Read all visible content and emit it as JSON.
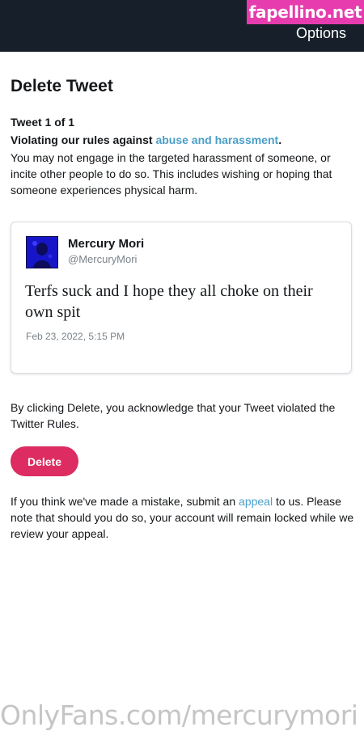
{
  "header": {
    "options_label": "Options"
  },
  "watermarks": {
    "top": "fapellino.net",
    "bottom": "OnlyFans.com/mercurymori"
  },
  "page": {
    "title": "Delete Tweet",
    "tweet_count": "Tweet 1 of 1",
    "rule_prefix": "Violating our rules against ",
    "rule_link": "abuse and harassment",
    "rule_suffix": ".",
    "rule_body": "You may not engage in the targeted harassment of someone, or incite other people to do so. This includes wishing or hoping that someone experiences physical harm."
  },
  "tweet": {
    "author_name": "Mercury Mori",
    "author_handle": "@MercuryMori",
    "text": "Terfs suck and I hope they all choke on their own spit",
    "date": "Feb 23, 2022, 5:15 PM"
  },
  "acknowledgement": "By clicking Delete, you acknowledge that your Tweet violated the Twitter Rules.",
  "delete_button_label": "Delete",
  "appeal": {
    "prefix": "If you think we've made a mistake, submit an ",
    "link": "appeal",
    "suffix": " to us. Please note that should you do so, your account will remain locked while we review your appeal."
  },
  "colors": {
    "header_bg": "#17202a",
    "link": "#4a9fc8",
    "delete_button": "#dc2c61",
    "watermark_badge": "#e63cae"
  }
}
